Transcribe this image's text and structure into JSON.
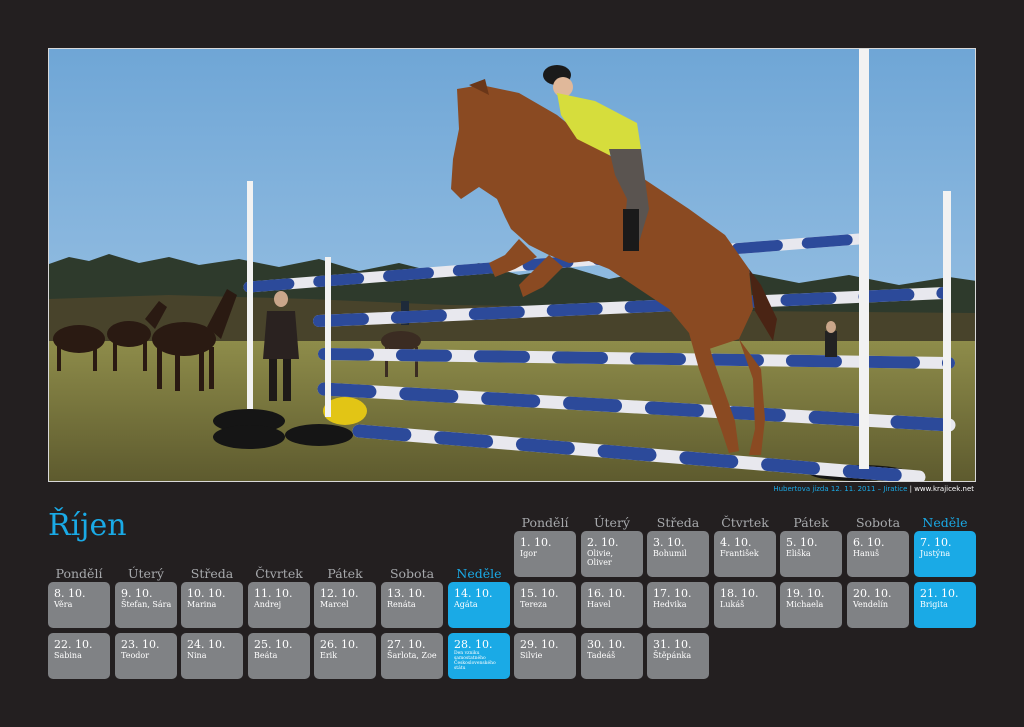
{
  "month_title": "Říjen",
  "caption": {
    "event": "Hubertova jízda 12. 11. 2011 – Jiratice",
    "site": "| www.krajicek.net"
  },
  "weekdays": [
    "Pondělí",
    "Úterý",
    "Středa",
    "Čtvrtek",
    "Pátek",
    "Sobota",
    "Neděle"
  ],
  "week1": [
    {
      "date": "1. 10.",
      "name": "Igor"
    },
    {
      "date": "2. 10.",
      "name": "Olivie, Oliver"
    },
    {
      "date": "3. 10.",
      "name": "Bohumil"
    },
    {
      "date": "4. 10.",
      "name": "František"
    },
    {
      "date": "5. 10.",
      "name": "Eliška"
    },
    {
      "date": "6. 10.",
      "name": "Hanuš"
    },
    {
      "date": "7. 10.",
      "name": "Justýna"
    }
  ],
  "week2": [
    {
      "date": "8. 10.",
      "name": "Věra"
    },
    {
      "date": "9. 10.",
      "name": "Štefan, Sára"
    },
    {
      "date": "10. 10.",
      "name": "Marina"
    },
    {
      "date": "11. 10.",
      "name": "Andrej"
    },
    {
      "date": "12. 10.",
      "name": "Marcel"
    },
    {
      "date": "13. 10.",
      "name": "Renáta"
    },
    {
      "date": "14. 10.",
      "name": "Agáta"
    }
  ],
  "week3": [
    {
      "date": "15. 10.",
      "name": "Tereza"
    },
    {
      "date": "16. 10.",
      "name": "Havel"
    },
    {
      "date": "17. 10.",
      "name": "Hedvika"
    },
    {
      "date": "18. 10.",
      "name": "Lukáš"
    },
    {
      "date": "19. 10.",
      "name": "Michaela"
    },
    {
      "date": "20. 10.",
      "name": "Vendelín"
    },
    {
      "date": "21. 10.",
      "name": "Brigita"
    }
  ],
  "week4": [
    {
      "date": "22. 10.",
      "name": "Sabina"
    },
    {
      "date": "23. 10.",
      "name": "Teodor"
    },
    {
      "date": "24. 10.",
      "name": "Nina"
    },
    {
      "date": "25. 10.",
      "name": "Beáta"
    },
    {
      "date": "26. 10.",
      "name": "Erik"
    },
    {
      "date": "27. 10.",
      "name": "Šarlota, Zoe"
    },
    {
      "date": "28. 10.",
      "name": "Den vzniku samostatného Československého státu"
    }
  ],
  "week5": [
    {
      "date": "29. 10.",
      "name": "Silvie"
    },
    {
      "date": "30. 10.",
      "name": "Tadeáš"
    },
    {
      "date": "31. 10.",
      "name": "Štěpánka"
    }
  ],
  "colors": {
    "background": "#231f20",
    "accent": "#1aaae6",
    "cell": "#808285",
    "header": "#a7a9ac"
  }
}
